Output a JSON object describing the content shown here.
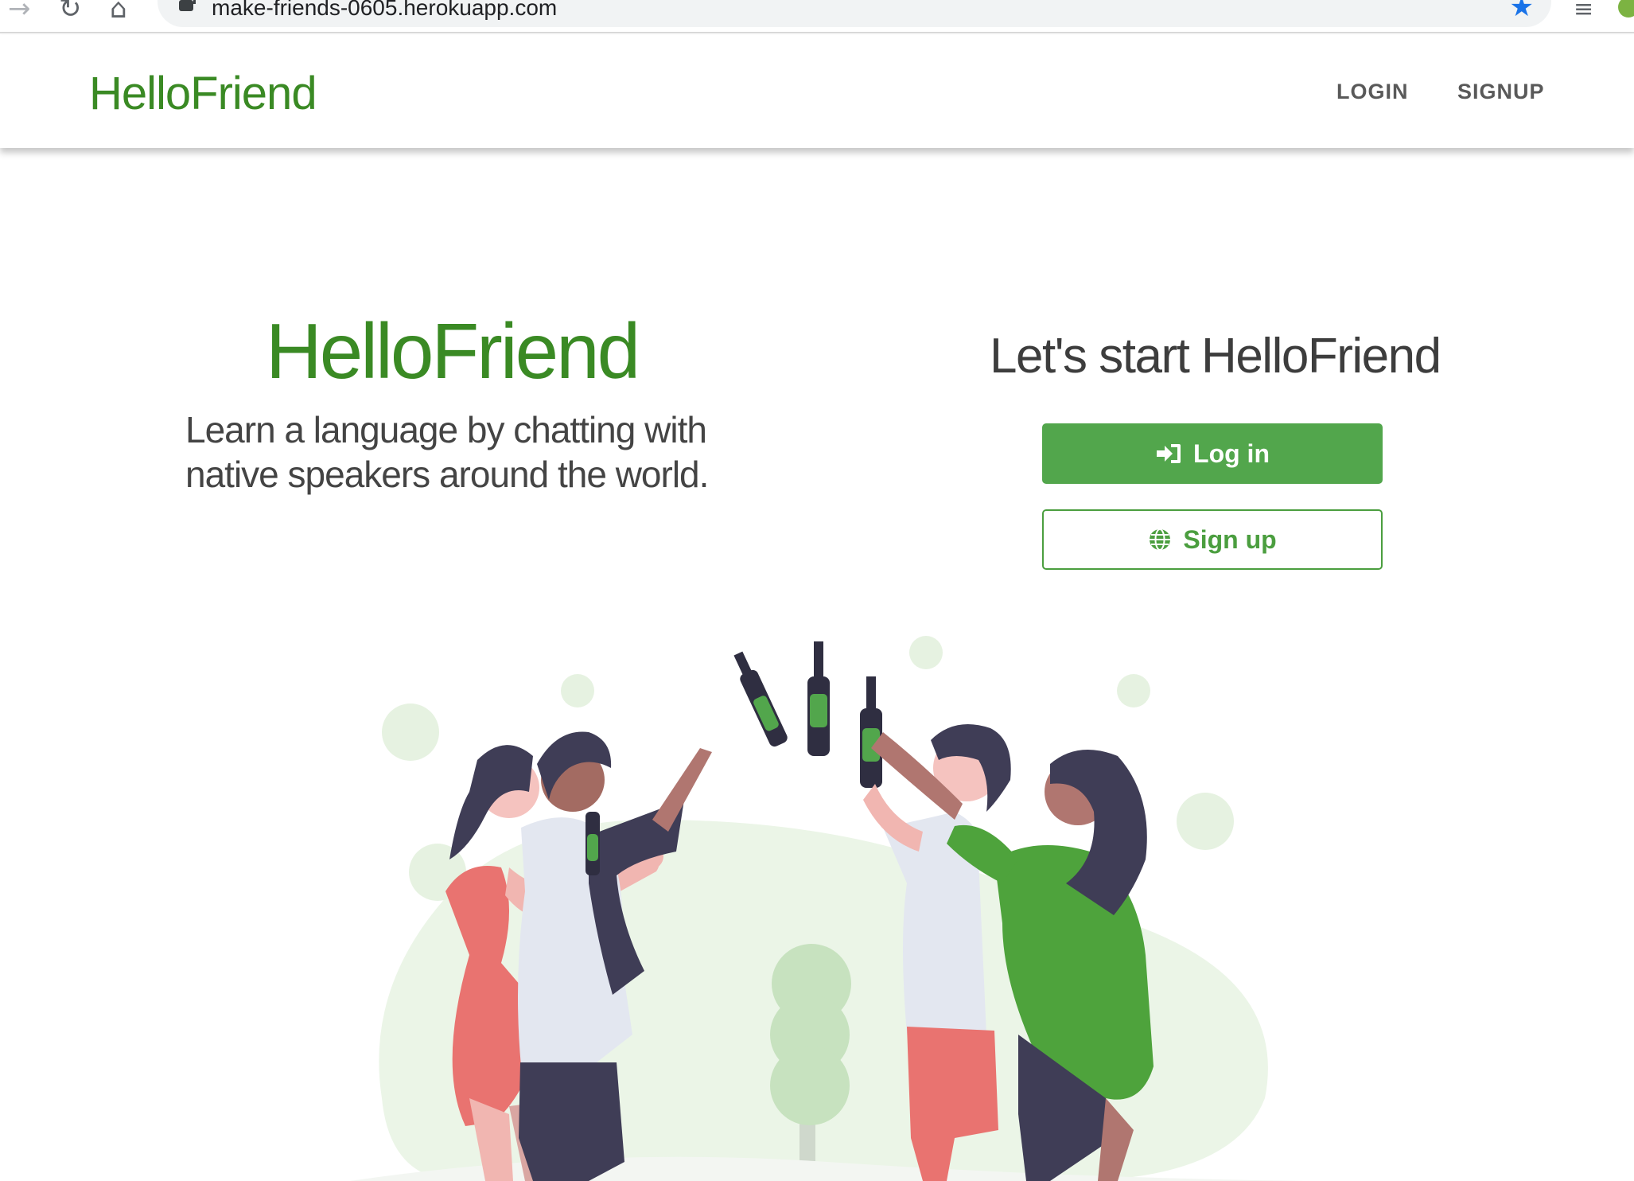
{
  "browser": {
    "url": "make-friends-0605.herokuapp.com",
    "icons": {
      "forward": "forward-arrow-icon",
      "reload": "reload-icon",
      "home": "home-icon",
      "lock": "lock-icon",
      "bookmark": "star-icon",
      "media": "media-queue-icon"
    }
  },
  "navbar": {
    "brand": "HelloFriend",
    "links": [
      {
        "label": "LOGIN"
      },
      {
        "label": "SIGNUP"
      }
    ]
  },
  "hero": {
    "title": "HelloFriend",
    "subtitle_line1": "Learn a language by chatting with",
    "subtitle_line2": "native speakers around the world."
  },
  "cta": {
    "title": "Let's start HelloFriend",
    "login_label": "Log in",
    "signup_label": "Sign up",
    "login_icon": "sign-in-icon",
    "signup_icon": "globe-icon"
  },
  "colors": {
    "brand_green": "#3a8a24",
    "button_green": "#52a64c",
    "illustration_light_green": "#e8f4e3",
    "dress_red": "#e97370",
    "dark_navy": "#3f3d56"
  }
}
